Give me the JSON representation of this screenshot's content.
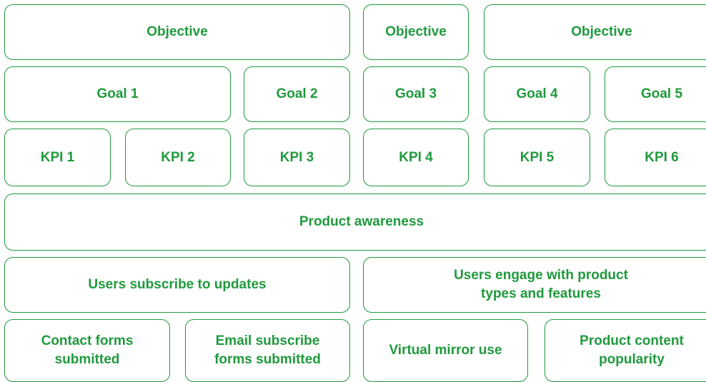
{
  "theme": {
    "accent": "#1f9a3c",
    "background": "#ffffff"
  },
  "objectives": [
    {
      "label": "Objective"
    },
    {
      "label": "Objective"
    },
    {
      "label": "Objective"
    }
  ],
  "goals": [
    {
      "label": "Goal 1"
    },
    {
      "label": "Goal 2"
    },
    {
      "label": "Goal 3"
    },
    {
      "label": "Goal 4"
    },
    {
      "label": "Goal 5"
    }
  ],
  "kpis": [
    {
      "label": "KPI 1"
    },
    {
      "label": "KPI 2"
    },
    {
      "label": "KPI 3"
    },
    {
      "label": "KPI 4"
    },
    {
      "label": "KPI 5"
    },
    {
      "label": "KPI 6"
    }
  ],
  "example": {
    "objective": "Product awareness",
    "goals": [
      {
        "label": "Users subscribe to updates"
      },
      {
        "label": "Users engage with product\ntypes and features"
      }
    ],
    "kpis": [
      {
        "label": "Contact forms\nsubmitted"
      },
      {
        "label": "Email subscribe\nforms submitted"
      },
      {
        "label": "Virtual mirror use"
      },
      {
        "label": "Product content\npopularity"
      }
    ]
  }
}
